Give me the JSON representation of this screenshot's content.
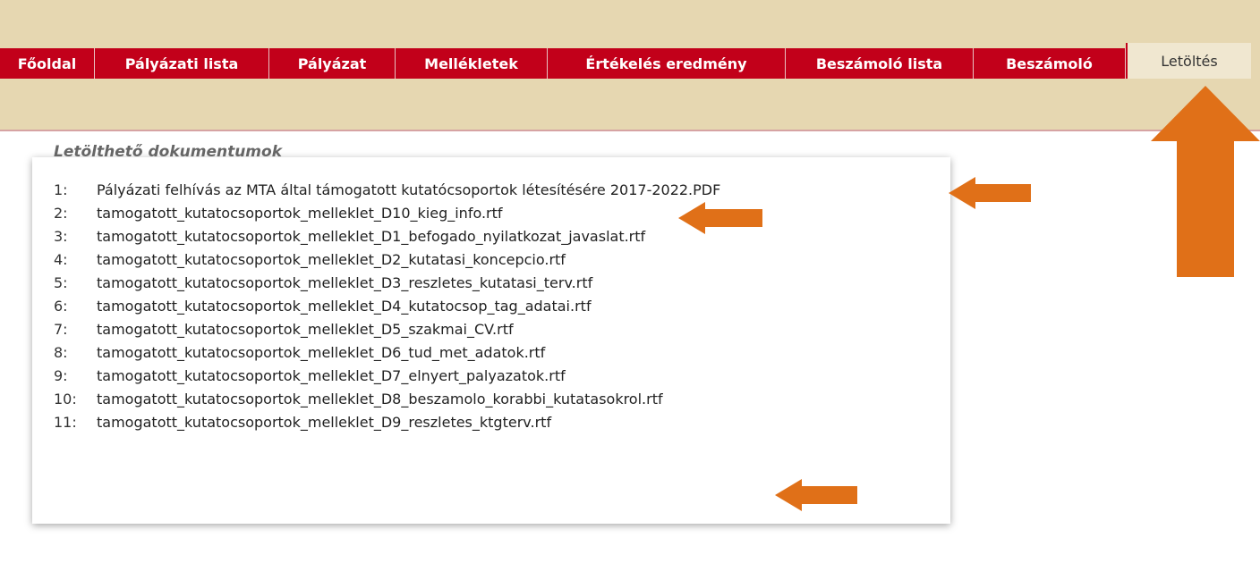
{
  "nav": {
    "tabs": [
      {
        "label": "Főoldal",
        "active": false
      },
      {
        "label": "Pályázati lista",
        "active": false
      },
      {
        "label": "Pályázat",
        "active": false
      },
      {
        "label": "Mellékletek",
        "active": false
      },
      {
        "label": "Értékelés eredmény",
        "active": false
      },
      {
        "label": "Beszámoló lista",
        "active": false
      },
      {
        "label": "Beszámoló",
        "active": false
      },
      {
        "label": "Letöltés",
        "active": true
      }
    ]
  },
  "documents": {
    "heading": "Letölthető dokumentumok",
    "items": [
      {
        "num": "1:",
        "name": "Pályázati felhívás az MTA által támogatott kutatócsoportok létesítésére 2017-2022.PDF"
      },
      {
        "num": "2:",
        "name": "tamogatott_kutatocsoportok_melleklet_D10_kieg_info.rtf"
      },
      {
        "num": "3:",
        "name": "tamogatott_kutatocsoportok_melleklet_D1_befogado_nyilatkozat_javaslat.rtf"
      },
      {
        "num": "4:",
        "name": "tamogatott_kutatocsoportok_melleklet_D2_kutatasi_koncepcio.rtf"
      },
      {
        "num": "5:",
        "name": "tamogatott_kutatocsoportok_melleklet_D3_reszletes_kutatasi_terv.rtf"
      },
      {
        "num": "6:",
        "name": "tamogatott_kutatocsoportok_melleklet_D4_kutatocsop_tag_adatai.rtf"
      },
      {
        "num": "7:",
        "name": "tamogatott_kutatocsoportok_melleklet_D5_szakmai_CV.rtf"
      },
      {
        "num": "8:",
        "name": "tamogatott_kutatocsoportok_melleklet_D6_tud_met_adatok.rtf"
      },
      {
        "num": "9:",
        "name": "tamogatott_kutatocsoportok_melleklet_D7_elnyert_palyazatok.rtf"
      },
      {
        "num": "10:",
        "name": "tamogatott_kutatocsoportok_melleklet_D8_beszamolo_korabbi_kutatasokrol.rtf"
      },
      {
        "num": "11:",
        "name": "tamogatott_kutatocsoportok_melleklet_D9_reszletes_ktgterv.rtf"
      }
    ]
  },
  "colors": {
    "tab_bg": "#c2001a",
    "active_tab_bg": "#f0e7d0",
    "header_bg": "#e6d7b1",
    "arrow": "#e07018"
  }
}
